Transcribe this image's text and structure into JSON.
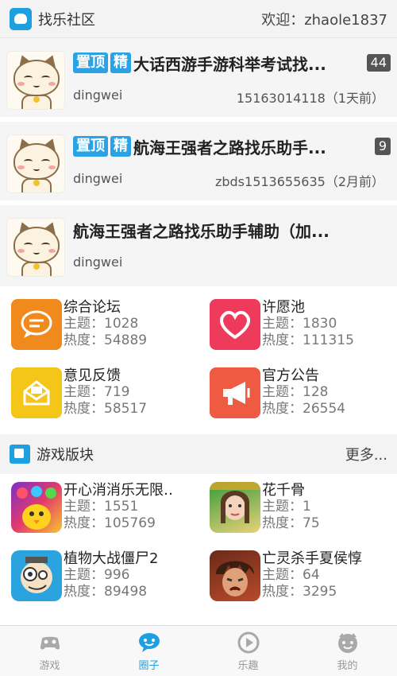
{
  "header": {
    "title": "找乐社区",
    "welcome": "欢迎：zhaole1837"
  },
  "posts": [
    {
      "tags": [
        "置顶",
        "精"
      ],
      "title": "大话西游手游科举考试找...",
      "count": "44",
      "author": "dingwei",
      "info": "15163014118（1天前）"
    },
    {
      "tags": [
        "置顶",
        "精"
      ],
      "title": "航海王强者之路找乐助手...",
      "count": "9",
      "author": "dingwei",
      "info": "zbds1513655635（2月前）"
    },
    {
      "tags": [],
      "title": "航海王强者之路找乐助手辅助（加...",
      "count": "",
      "author": "dingwei",
      "info": ""
    }
  ],
  "forums": [
    {
      "name": "综合论坛",
      "topics": "主题：1028",
      "heat": "热度：54889",
      "color": "#f08a1c",
      "icon": "chat-bubble-icon"
    },
    {
      "name": "许愿池",
      "topics": "主题：1830",
      "heat": "热度：111315",
      "color": "#ee3a5b",
      "icon": "heart-icon"
    },
    {
      "name": "意见反馈",
      "topics": "主题：719",
      "heat": "热度：58517",
      "color": "#f5c518",
      "icon": "envelope-icon"
    },
    {
      "name": "官方公告",
      "topics": "主题：128",
      "heat": "热度：26554",
      "color": "#ee5a42",
      "icon": "megaphone-icon"
    }
  ],
  "games_section": {
    "title": "游戏版块",
    "more": "更多..."
  },
  "games": [
    {
      "name": "开心消消乐无限…",
      "topics": "主题：1551",
      "heat": "热度：105769",
      "icon": "candy-game-icon"
    },
    {
      "name": "花千骨",
      "topics": "主题：1",
      "heat": "热度：75",
      "icon": "hua-qian-gu-icon"
    },
    {
      "name": "植物大战僵尸2",
      "topics": "主题：996",
      "heat": "热度：89498",
      "icon": "plants-zombies-icon"
    },
    {
      "name": "亡灵杀手夏侯惇",
      "topics": "主题：64",
      "heat": "热度：3295",
      "icon": "undead-slayer-icon"
    }
  ],
  "tabs": [
    {
      "label": "游戏",
      "icon": "gamepad-icon",
      "active": false
    },
    {
      "label": "圈子",
      "icon": "chat-icon",
      "active": true
    },
    {
      "label": "乐趣",
      "icon": "play-icon",
      "active": false
    },
    {
      "label": "我的",
      "icon": "face-icon",
      "active": false
    }
  ],
  "colors": {
    "accent": "#1e9fe0",
    "tag": "#29a3e6",
    "inactive_tab": "#a9a9a9"
  }
}
